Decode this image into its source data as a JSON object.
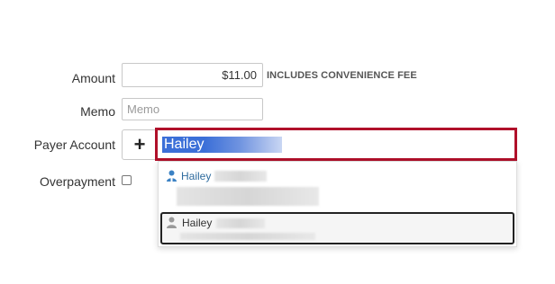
{
  "form": {
    "amount": {
      "label": "Amount",
      "value": "$11.00",
      "note": "INCLUDES CONVENIENCE FEE"
    },
    "memo": {
      "label": "Memo",
      "placeholder": "Memo",
      "value": ""
    },
    "payer_account": {
      "label": "Payer Account",
      "add_label": "+",
      "search_value": "Hailey"
    },
    "overpayment": {
      "label": "Overpayment",
      "checked": false
    }
  },
  "dropdown": {
    "options": [
      {
        "name": "Hailey",
        "icon": "person-icon",
        "icon_color": "#3b82c4"
      },
      {
        "name": "Hailey",
        "icon": "person-icon",
        "icon_color": "#9a9a9a"
      }
    ]
  },
  "colors": {
    "focus_border": "#b0102a",
    "selection": "#3b6fd8",
    "highlight_border": "#222222"
  }
}
